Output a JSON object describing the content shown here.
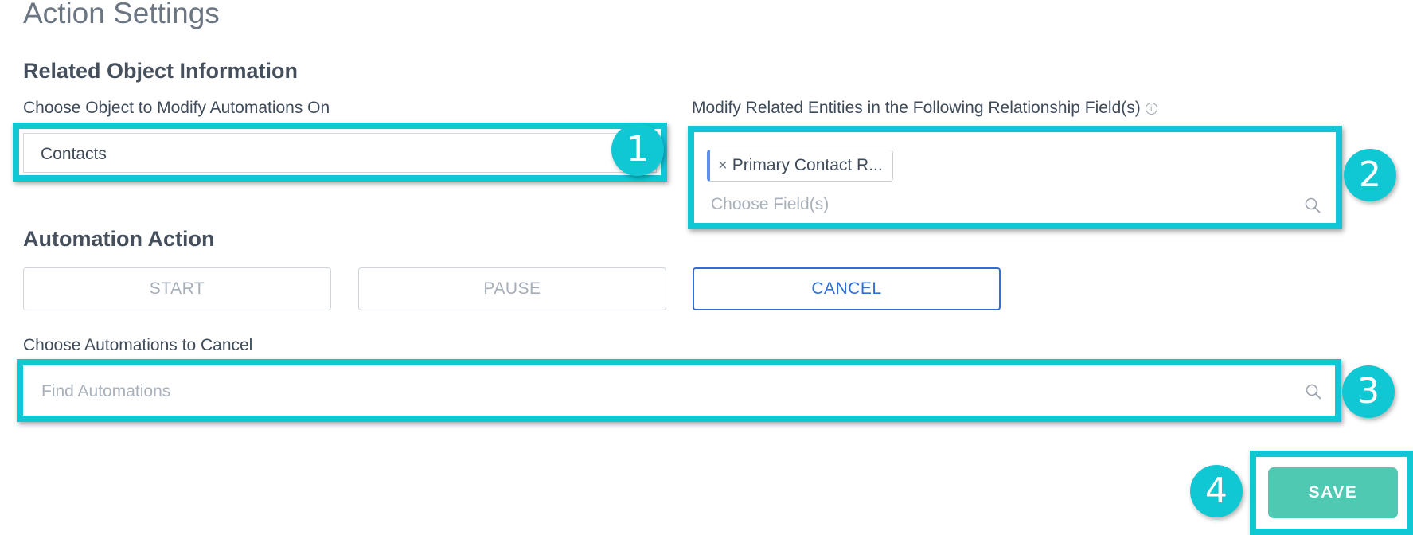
{
  "page": {
    "title": "Action Settings"
  },
  "related_object": {
    "heading": "Related Object Information",
    "object_label": "Choose Object to Modify Automations On",
    "object_value": "Contacts",
    "relationship_label": "Modify Related Entities in the Following Relationship Field(s)",
    "selected_tag": "Primary Contact R...",
    "fields_placeholder": "Choose Field(s)"
  },
  "automation_action": {
    "heading": "Automation Action",
    "buttons": [
      {
        "label": "START",
        "selected": false
      },
      {
        "label": "PAUSE",
        "selected": false
      },
      {
        "label": "CANCEL",
        "selected": true
      }
    ],
    "automations_label": "Choose Automations to Cancel",
    "automations_placeholder": "Find Automations"
  },
  "footer": {
    "save_label": "SAVE"
  },
  "annotations": [
    "1",
    "2",
    "3",
    "4"
  ],
  "colors": {
    "highlight": "#10c8d4",
    "selected_action": "#2f6fdb",
    "save_button": "#4fc9b2",
    "tag_accent": "#5b8ff0"
  },
  "icons": [
    "info-icon",
    "remove-tag-icon",
    "search-icon"
  ]
}
